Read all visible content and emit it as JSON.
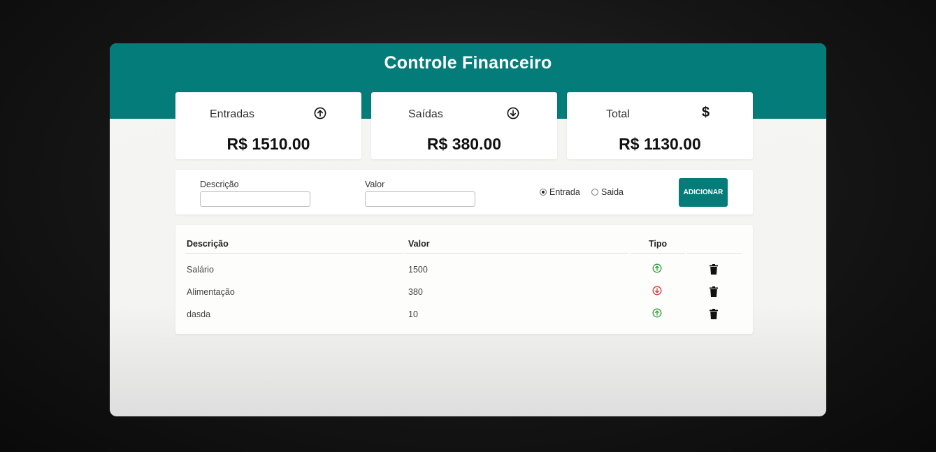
{
  "app": {
    "title": "Controle Financeiro"
  },
  "summary": {
    "entradas": {
      "label": "Entradas",
      "value": "R$ 1510.00",
      "icon": "arrow-up-circle-icon"
    },
    "saidas": {
      "label": "Saídas",
      "value": "R$ 380.00",
      "icon": "arrow-down-circle-icon"
    },
    "total": {
      "label": "Total",
      "value": "R$ 1130.00",
      "icon": "dollar-icon",
      "icon_glyph": "$"
    }
  },
  "form": {
    "descricao_label": "Descrição",
    "descricao_value": "",
    "valor_label": "Valor",
    "valor_value": "",
    "radio_entrada": "Entrada",
    "radio_saida": "Saida",
    "selected": "Entrada",
    "add_button": "ADICIONAR"
  },
  "table": {
    "headers": {
      "descricao": "Descrição",
      "valor": "Valor",
      "tipo": "Tipo"
    },
    "rows": [
      {
        "descricao": "Salário",
        "valor": "1500",
        "tipo": "entrada"
      },
      {
        "descricao": "Alimentação",
        "valor": "380",
        "tipo": "saida"
      },
      {
        "descricao": "dasda",
        "valor": "10",
        "tipo": "entrada"
      }
    ]
  },
  "nav": {
    "prev": "«",
    "next": "»"
  },
  "colors": {
    "accent": "#047c7a",
    "entrada": "#2e9e3a",
    "saida": "#d9363e"
  }
}
